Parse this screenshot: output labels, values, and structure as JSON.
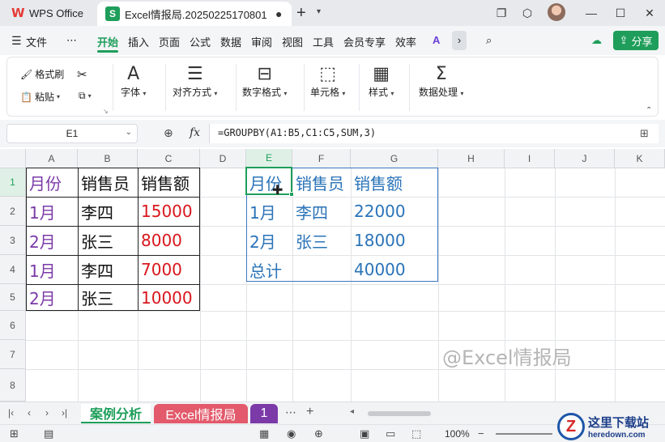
{
  "titlebar": {
    "app_name": "WPS Office",
    "doc_tab": "Excel情报局.20250225170801",
    "doc_badge": "S",
    "modified_dot": "●"
  },
  "menu": {
    "file": "文件",
    "more": "⋯",
    "items": [
      "开始",
      "插入",
      "页面",
      "公式",
      "数据",
      "审阅",
      "视图",
      "工具",
      "会员专享",
      "效率"
    ],
    "share": "分享"
  },
  "ribbon": {
    "format_painter": "格式刷",
    "paste": "粘贴",
    "font": "字体",
    "align": "对齐方式",
    "number": "数字格式",
    "cell": "单元格",
    "style": "样式",
    "data": "数据处理"
  },
  "formula_bar": {
    "name_box": "E1",
    "fx": "fx",
    "formula": "=GROUPBY(A1:B5,C1:C5,SUM,3)"
  },
  "columns": [
    "A",
    "B",
    "C",
    "D",
    "E",
    "F",
    "G",
    "H",
    "I",
    "J",
    "K"
  ],
  "rows": [
    "1",
    "2",
    "3",
    "4",
    "5",
    "6",
    "7",
    "8"
  ],
  "source_table": {
    "header": [
      "月份",
      "销售员",
      "销售额"
    ],
    "rows": [
      [
        "1月",
        "李四",
        "15000"
      ],
      [
        "2月",
        "张三",
        "8000"
      ],
      [
        "1月",
        "李四",
        "7000"
      ],
      [
        "2月",
        "张三",
        "10000"
      ]
    ]
  },
  "result_table": {
    "header": [
      "月份",
      "销售员",
      "销售额"
    ],
    "rows": [
      [
        "1月",
        "李四",
        "22000"
      ],
      [
        "2月",
        "张三",
        "18000"
      ],
      [
        "总计",
        "",
        "40000"
      ]
    ]
  },
  "watermark": "@Excel情报局",
  "sheets": {
    "active": "案例分析",
    "second": "Excel情报局",
    "third": "1",
    "more": "⋯",
    "add": "+"
  },
  "status": {
    "zoom": "100%"
  },
  "site_logo": {
    "letter": "Z",
    "main": "这里下载站",
    "sub": "heredown.com"
  },
  "colors": {
    "accent": "#1e9e5a",
    "month_purple": "#7b3aa8",
    "amount_red": "#d9161c",
    "result_blue": "#2a73b8"
  }
}
